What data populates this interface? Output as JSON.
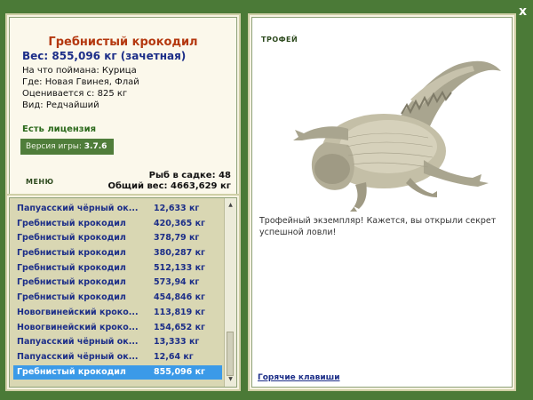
{
  "fish": {
    "name": "Гребнистый крокодил",
    "weight": "Вес: 855,096 кг (зачетная)",
    "bait": "На что поймана: Курица",
    "location": "Где: Новая Гвинея, Флай",
    "valued_from": "Оценивается с: 825 кг",
    "kind": "Вид: Редчайший"
  },
  "license": "Есть лицензия",
  "version": {
    "label": "Версия игры: ",
    "value": "3.7.6"
  },
  "menu_label": "МЕНЮ",
  "tank": {
    "count": "Рыб в садке: 48",
    "total": "Общий вес: 4663,629 кг"
  },
  "catch_list": [
    {
      "name": "Папуасский чёрный ок...",
      "weight": "12,633 кг"
    },
    {
      "name": "Гребнистый крокодил",
      "weight": "420,365 кг"
    },
    {
      "name": "Гребнистый крокодил",
      "weight": "378,79 кг"
    },
    {
      "name": "Гребнистый крокодил",
      "weight": "380,287 кг"
    },
    {
      "name": "Гребнистый крокодил",
      "weight": "512,133 кг"
    },
    {
      "name": "Гребнистый крокодил",
      "weight": "573,94 кг"
    },
    {
      "name": "Гребнистый крокодил",
      "weight": "454,846 кг"
    },
    {
      "name": "Новогвинейский кроко...",
      "weight": "113,819 кг"
    },
    {
      "name": "Новогвинейский кроко...",
      "weight": "154,652 кг"
    },
    {
      "name": "Папуасский чёрный ок...",
      "weight": "13,333 кг"
    },
    {
      "name": "Папуасский чёрный ок...",
      "weight": "12,64 кг"
    },
    {
      "name": "Гребнистый крокодил",
      "weight": "855,096 кг",
      "selected": true
    }
  ],
  "trophy": {
    "label": "ТРОФЕЙ",
    "text": "Трофейный экземпляр! Кажется, вы открыли секрет успешной ловли!"
  },
  "hotkeys": "Горячие клавиши",
  "close": "x",
  "icons": {
    "close": "close-icon",
    "scroll_up": "arrow-up-icon",
    "scroll_down": "arrow-down-icon"
  },
  "colors": {
    "background": "#4b7a37",
    "selected": "#3b9ae8",
    "title": "#b4380f",
    "accent": "#1c2e88"
  }
}
